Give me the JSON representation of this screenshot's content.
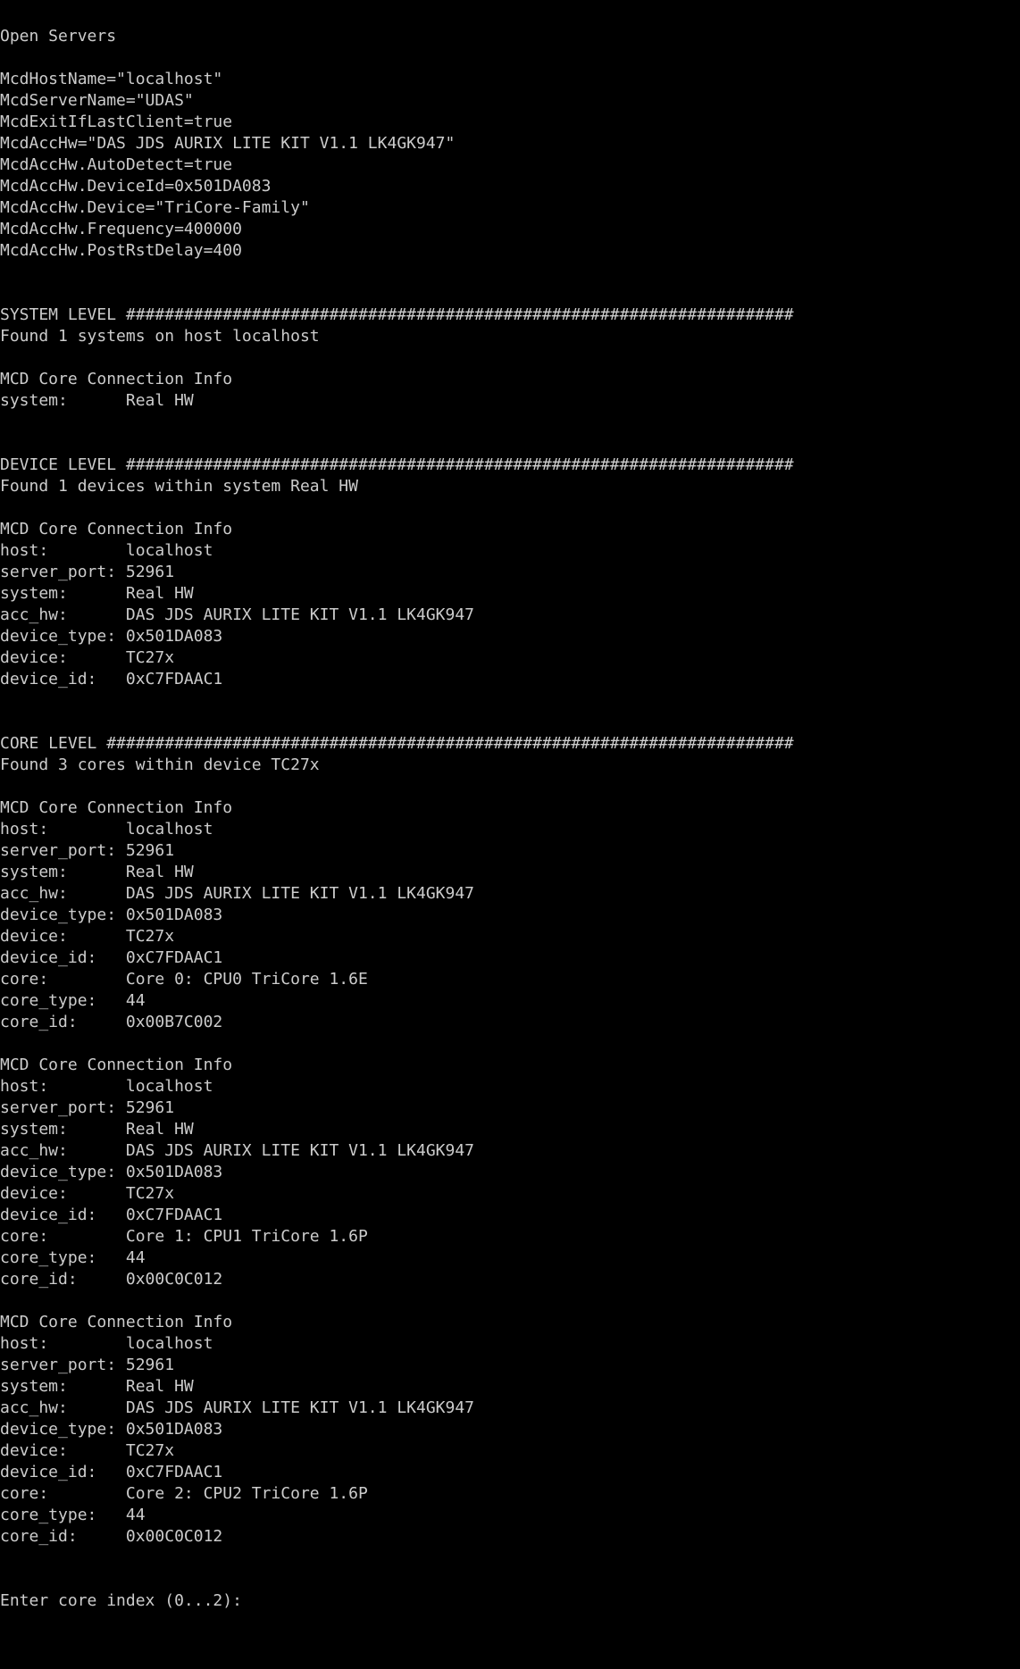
{
  "console": {
    "lines": [
      "Open Servers",
      "",
      "McdHostName=\"localhost\"",
      "McdServerName=\"UDAS\"",
      "McdExitIfLastClient=true",
      "McdAccHw=\"DAS JDS AURIX LITE KIT V1.1 LK4GK947\"",
      "McdAccHw.AutoDetect=true",
      "McdAccHw.DeviceId=0x501DA083",
      "McdAccHw.Device=\"TriCore-Family\"",
      "McdAccHw.Frequency=400000",
      "McdAccHw.PostRstDelay=400",
      "",
      "",
      "SYSTEM LEVEL #####################################################################",
      "Found 1 systems on host localhost",
      "",
      "MCD Core Connection Info",
      "system:      Real HW",
      "",
      "",
      "DEVICE LEVEL #####################################################################",
      "Found 1 devices within system Real HW",
      "",
      "MCD Core Connection Info",
      "host:        localhost",
      "server_port: 52961",
      "system:      Real HW",
      "acc_hw:      DAS JDS AURIX LITE KIT V1.1 LK4GK947",
      "device_type: 0x501DA083",
      "device:      TC27x",
      "device_id:   0xC7FDAAC1",
      "",
      "",
      "CORE LEVEL #######################################################################",
      "Found 3 cores within device TC27x",
      "",
      "MCD Core Connection Info",
      "host:        localhost",
      "server_port: 52961",
      "system:      Real HW",
      "acc_hw:      DAS JDS AURIX LITE KIT V1.1 LK4GK947",
      "device_type: 0x501DA083",
      "device:      TC27x",
      "device_id:   0xC7FDAAC1",
      "core:        Core 0: CPU0 TriCore 1.6E",
      "core_type:   44",
      "core_id:     0x00B7C002",
      "",
      "MCD Core Connection Info",
      "host:        localhost",
      "server_port: 52961",
      "system:      Real HW",
      "acc_hw:      DAS JDS AURIX LITE KIT V1.1 LK4GK947",
      "device_type: 0x501DA083",
      "device:      TC27x",
      "device_id:   0xC7FDAAC1",
      "core:        Core 1: CPU1 TriCore 1.6P",
      "core_type:   44",
      "core_id:     0x00C0C012",
      "",
      "MCD Core Connection Info",
      "host:        localhost",
      "server_port: 52961",
      "system:      Real HW",
      "acc_hw:      DAS JDS AURIX LITE KIT V1.1 LK4GK947",
      "device_type: 0x501DA083",
      "device:      TC27x",
      "device_id:   0xC7FDAAC1",
      "core:        Core 2: CPU2 TriCore 1.6P",
      "core_type:   44",
      "core_id:     0x00C0C012",
      "",
      ""
    ],
    "prompt": "Enter core index (0...2): "
  },
  "colors": {
    "background": "#000000",
    "text": "#cccccc"
  }
}
